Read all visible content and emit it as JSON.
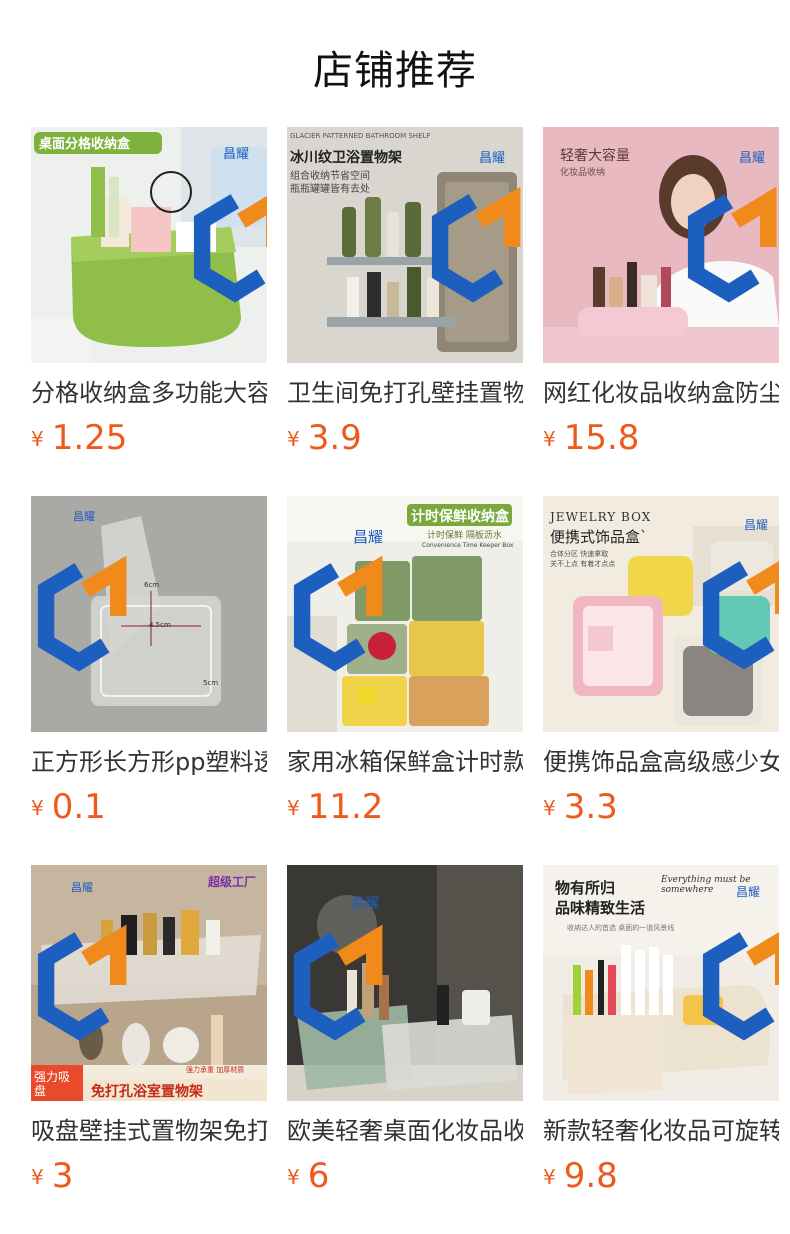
{
  "header": {
    "title": "店铺推荐"
  },
  "currency_symbol": "¥",
  "brand_logo_text": "昌耀",
  "products": [
    {
      "name": "分格收纳盒多功能大容量桌面收纳盒",
      "price": "1.25",
      "image_text": [
        "桌面分格收纳盒"
      ]
    },
    {
      "name": "卫生间免打孔壁挂置物架冰川纹",
      "price": "3.9",
      "image_text": [
        "GLACIER PATTERNED BATHROOM SHELF",
        "冰川纹卫浴置物架",
        "组合收纳节省空间",
        "瓶瓶罐罐皆有去处"
      ]
    },
    {
      "name": "网红化妆品收纳盒防尘大容量",
      "price": "15.8",
      "image_text": [
        "轻奢大容量",
        "化妆品收纳"
      ]
    },
    {
      "name": "正方形长方形pp塑料透明盒",
      "price": "0.1",
      "image_text": [
        "6cm",
        "4.5cm",
        "5cm"
      ]
    },
    {
      "name": "家用冰箱保鲜盒计时款",
      "price": "11.2",
      "image_text": [
        "计时保鲜收纳盒",
        "计时保鲜 隔板沥水",
        "Convenience Time Keeper Box"
      ]
    },
    {
      "name": "便携饰品盒高级感少女",
      "price": "3.3",
      "image_text": [
        "JEWELRY BOX",
        "便携式饰品盒`",
        "合体分区 快速拿取",
        "关不上点 有着才点点"
      ]
    },
    {
      "name": "吸盘壁挂式置物架免打孔",
      "price": "3",
      "image_text": [
        "超级工厂",
        "强力承重 加厚材质",
        "强力吸盘",
        "免打孔浴室置物架"
      ]
    },
    {
      "name": "欧美轻奢桌面化妆品收纳",
      "price": "6",
      "image_text": []
    },
    {
      "name": "新款轻奢化妆品可旋转收纳",
      "price": "9.8",
      "image_text": [
        "物有所归",
        "品味精致生活",
        "Everything must be somewhere",
        "收纳达人的首选 桌面的一道风景线"
      ]
    }
  ]
}
